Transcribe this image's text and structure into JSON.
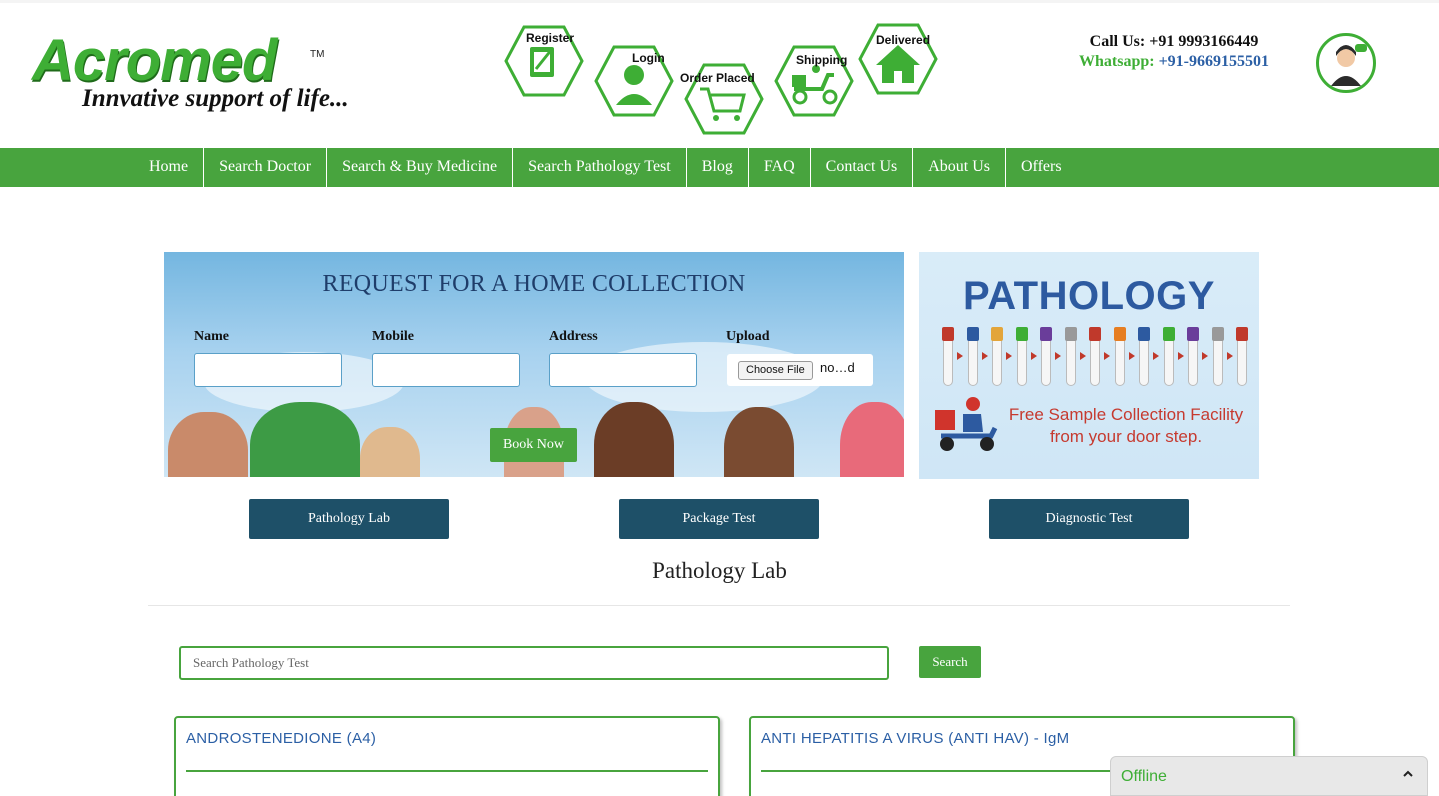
{
  "header": {
    "logo": {
      "brand": "Acromed",
      "tm": "TM",
      "tagline": "Innvative support of life..."
    },
    "steps": [
      {
        "label": "Register",
        "icon": "register-icon"
      },
      {
        "label": "Login",
        "icon": "login-icon"
      },
      {
        "label": "Order Placed",
        "icon": "cart-icon"
      },
      {
        "label": "Shipping",
        "icon": "scooter-icon"
      },
      {
        "label": "Delivered",
        "icon": "house-icon"
      }
    ],
    "contact": {
      "call": "Call Us: +91 9993166449",
      "whatsapp_label": "Whatsapp:",
      "whatsapp_number": "+91-9669155501"
    },
    "agent_icon": "support-agent-icon"
  },
  "nav": {
    "items": [
      "Home",
      "Search Doctor",
      "Search & Buy Medicine",
      "Search Pathology Test",
      "Blog",
      "FAQ",
      "Contact Us",
      "About Us",
      "Offers"
    ]
  },
  "banner": {
    "title": "REQUEST FOR A HOME COLLECTION",
    "fields": {
      "name": "Name",
      "mobile": "Mobile",
      "address": "Address",
      "upload": "Upload"
    },
    "file_button": "Choose File",
    "file_name": "no…d",
    "book_button": "Book Now"
  },
  "pathology_card": {
    "title": "PATHOLOGY",
    "free_text_line1": "Free Sample Collection Facility",
    "free_text_line2": "from your door step."
  },
  "tabs": [
    "Pathology Lab",
    "Package Test",
    "Diagnostic Test"
  ],
  "section_title": "Pathology Lab",
  "search": {
    "placeholder": "Search Pathology Test",
    "button": "Search"
  },
  "tests": [
    "ANDROSTENEDIONE (A4)",
    "ANTI HEPATITIS A VIRUS (ANTI HAV) - IgM"
  ],
  "chat": {
    "status": "Offline"
  },
  "colors": {
    "brand_green": "#48a43e",
    "tab_blue": "#1e5068",
    "link_blue": "#2b5fa5",
    "title_navy": "#1f3d6a"
  }
}
